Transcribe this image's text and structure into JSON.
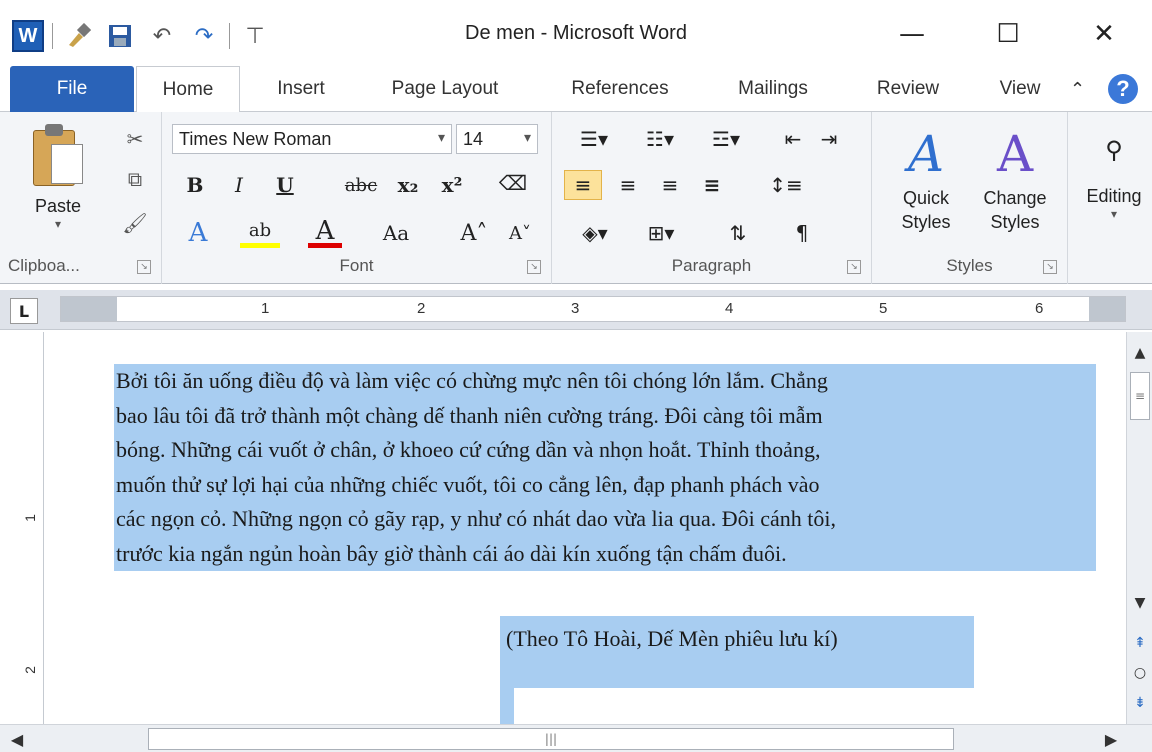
{
  "window": {
    "title": "De men  -  Microsoft Word",
    "minimize_glyph": "—",
    "maximize_glyph": "☐",
    "close_glyph": "✕"
  },
  "quick_access": {
    "app_icon_letter": "W",
    "undo_glyph": "↶",
    "redo_glyph": "↷",
    "customize_glyph": "⊤"
  },
  "tabs": {
    "file": "File",
    "home": "Home",
    "insert": "Insert",
    "page_layout": "Page Layout",
    "references": "References",
    "mailings": "Mailings",
    "review": "Review",
    "view": "View",
    "help_glyph": "?"
  },
  "ribbon": {
    "clipboard": {
      "label": "Clipboa...",
      "paste_label": "Paste"
    },
    "font": {
      "label": "Font",
      "font_name": "Times New Roman",
      "font_size": "14",
      "bold": "B",
      "italic": "I",
      "underline": "U",
      "strikethrough": "abc",
      "subscript": "x₂",
      "superscript": "x²",
      "change_case": "Aa",
      "grow": "A˄",
      "shrink": "A˅"
    },
    "paragraph": {
      "label": "Paragraph",
      "pilcrow": "¶"
    },
    "styles": {
      "label": "Styles",
      "quick_styles": "Quick\nStyles",
      "change_styles": "Change\nStyles"
    },
    "editing": {
      "label": "Editing"
    }
  },
  "ruler": {
    "tab_selector": "L",
    "numbers": [
      "1",
      "2",
      "3",
      "4",
      "5",
      "6"
    ]
  },
  "vertical_ruler": {
    "numbers": [
      "1",
      "2"
    ]
  },
  "document": {
    "lines": [
      "Bởi tôi ăn uống điều độ và làm việc có chừng mực nên tôi chóng lớn lắm. Chẳng",
      "bao lâu tôi đã trở thành một chàng dế thanh niên cường tráng. Đôi càng tôi mẫm",
      "bóng. Những cái vuốt ở chân, ở khoeo cứ cứng dần và nhọn hoắt. Thỉnh thoảng,",
      "muốn thử sự lợi hại của những chiếc vuốt, tôi co cẳng lên, đạp phanh phách vào",
      "các ngọn cỏ. Những ngọn cỏ gãy rạp, y như có nhát dao vừa lia qua. Đôi cánh tôi,",
      "trước kia ngắn ngủn hoàn bây giờ thành cái áo dài kín xuống tận chấm đuôi."
    ],
    "citation": "(Theo Tô Hoài, Dế Mèn phiêu lưu kí)",
    "selection_color": "#a8cdf1"
  },
  "colors": {
    "file_tab": "#2a63b8",
    "ribbon_bg": "#f3f5f8",
    "selected_button": "#fce29b"
  }
}
